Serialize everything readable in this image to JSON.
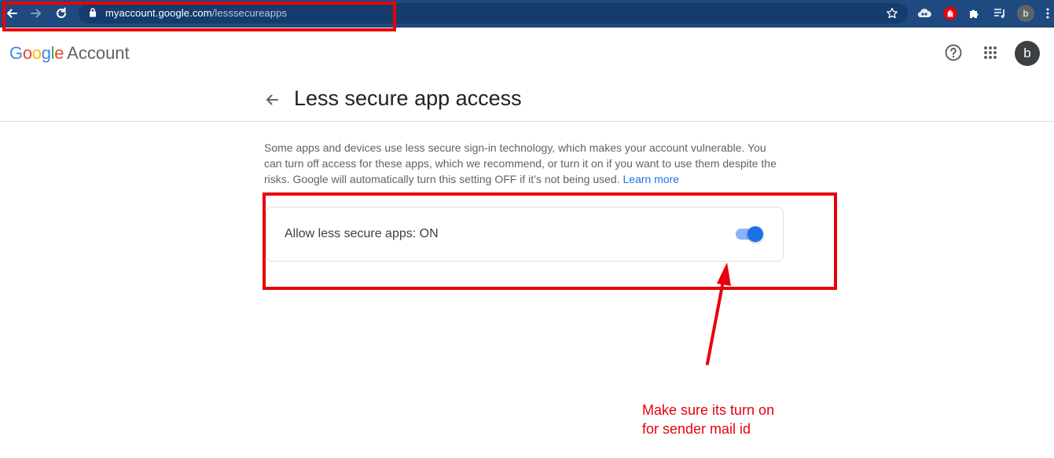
{
  "browser": {
    "url_host": "myaccount.google.com",
    "url_path": "/lesssecureapps",
    "profile_letter": "b",
    "icons": [
      "back-icon",
      "forward-icon",
      "reload-icon",
      "lock-icon",
      "bookmark-star-icon",
      "extension-cloud-icon",
      "extension-hand-icon",
      "extensions-puzzle-icon",
      "reading-list-icon",
      "menu-dots-icon"
    ]
  },
  "header": {
    "brand": "Google",
    "product": "Account",
    "avatar_letter": "b",
    "icons": [
      "help-icon",
      "apps-grid-icon"
    ]
  },
  "page": {
    "title": "Less secure app access",
    "description": "Some apps and devices use less secure sign-in technology, which makes your account vulnerable. You can turn off access for these apps, which we recommend, or turn it on if you want to use them despite the risks. Google will automatically turn this setting OFF if it’s not being used.",
    "learn_more": "Learn more"
  },
  "setting": {
    "label": "Allow less secure apps: ON",
    "enabled": true
  },
  "annotation": {
    "note_line1": "Make sure its turn on",
    "note_line2": "for sender mail id",
    "color": "#e8000b"
  },
  "colors": {
    "accent": "#1a73e8",
    "chrome": "#1f4a80"
  }
}
